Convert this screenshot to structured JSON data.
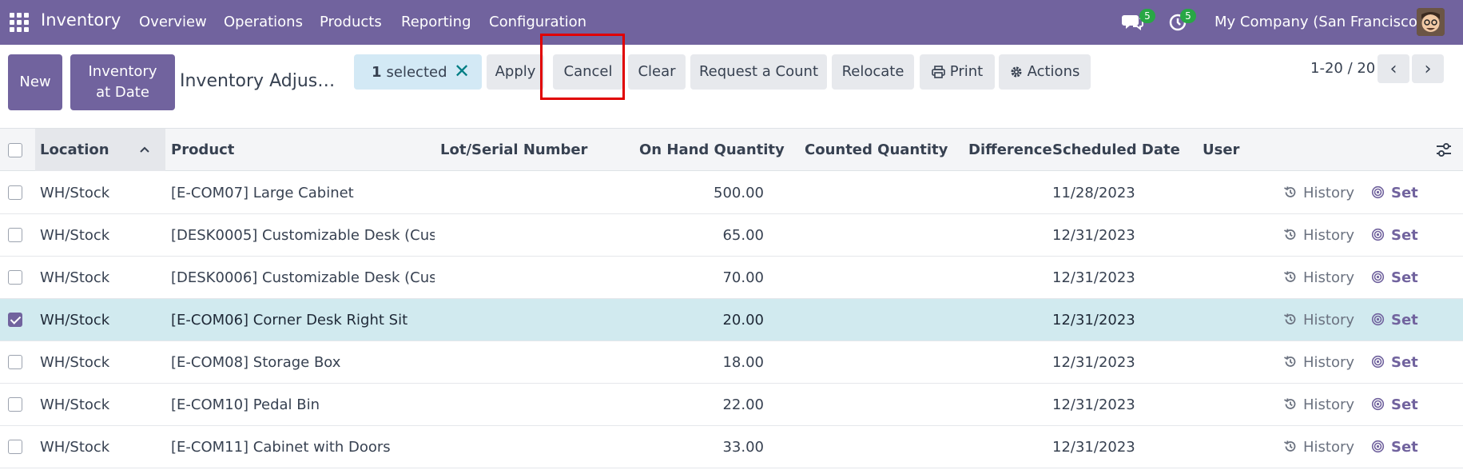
{
  "nav": {
    "app_name": "Inventory",
    "menu": [
      "Overview",
      "Operations",
      "Products",
      "Reporting",
      "Configuration"
    ],
    "messages_badge": "5",
    "activities_badge": "5",
    "company": "My Company (San Francisco)"
  },
  "control": {
    "new_label": "New",
    "inventory_at_date_line1": "Inventory",
    "inventory_at_date_line2": "at Date",
    "breadcrumb": "Inventory Adjus…",
    "selected_count": "1",
    "selected_label": "selected",
    "buttons": {
      "apply": "Apply",
      "cancel": "Cancel",
      "clear": "Clear",
      "request_count": "Request a Count",
      "relocate": "Relocate",
      "print": "Print",
      "actions": "Actions"
    },
    "pager": "1-20 / 20"
  },
  "table": {
    "headers": {
      "location": "Location",
      "product": "Product",
      "lot": "Lot/Serial Number",
      "on_hand": "On Hand Quantity",
      "counted": "Counted Quantity",
      "difference": "Difference",
      "scheduled": "Scheduled Date",
      "user": "User"
    },
    "history_label": "History",
    "set_label": "Set",
    "rows": [
      {
        "location": "WH/Stock",
        "product": "[E-COM07] Large Cabinet",
        "on_hand": "500.00",
        "scheduled": "11/28/2023",
        "selected": false
      },
      {
        "location": "WH/Stock",
        "product": "[DESK0005] Customizable Desk (Cus…",
        "on_hand": "65.00",
        "scheduled": "12/31/2023",
        "selected": false
      },
      {
        "location": "WH/Stock",
        "product": "[DESK0006] Customizable Desk (Cus…",
        "on_hand": "70.00",
        "scheduled": "12/31/2023",
        "selected": false
      },
      {
        "location": "WH/Stock",
        "product": "[E-COM06] Corner Desk Right Sit",
        "on_hand": "20.00",
        "scheduled": "12/31/2023",
        "selected": true
      },
      {
        "location": "WH/Stock",
        "product": "[E-COM08] Storage Box",
        "on_hand": "18.00",
        "scheduled": "12/31/2023",
        "selected": false
      },
      {
        "location": "WH/Stock",
        "product": "[E-COM10] Pedal Bin",
        "on_hand": "22.00",
        "scheduled": "12/31/2023",
        "selected": false
      },
      {
        "location": "WH/Stock",
        "product": "[E-COM11] Cabinet with Doors",
        "on_hand": "33.00",
        "scheduled": "12/31/2023",
        "selected": false
      }
    ]
  },
  "colors": {
    "brand": "#71639e",
    "selected_row": "#d1eaef",
    "highlight": "#e00000",
    "badge": "#28a745"
  }
}
